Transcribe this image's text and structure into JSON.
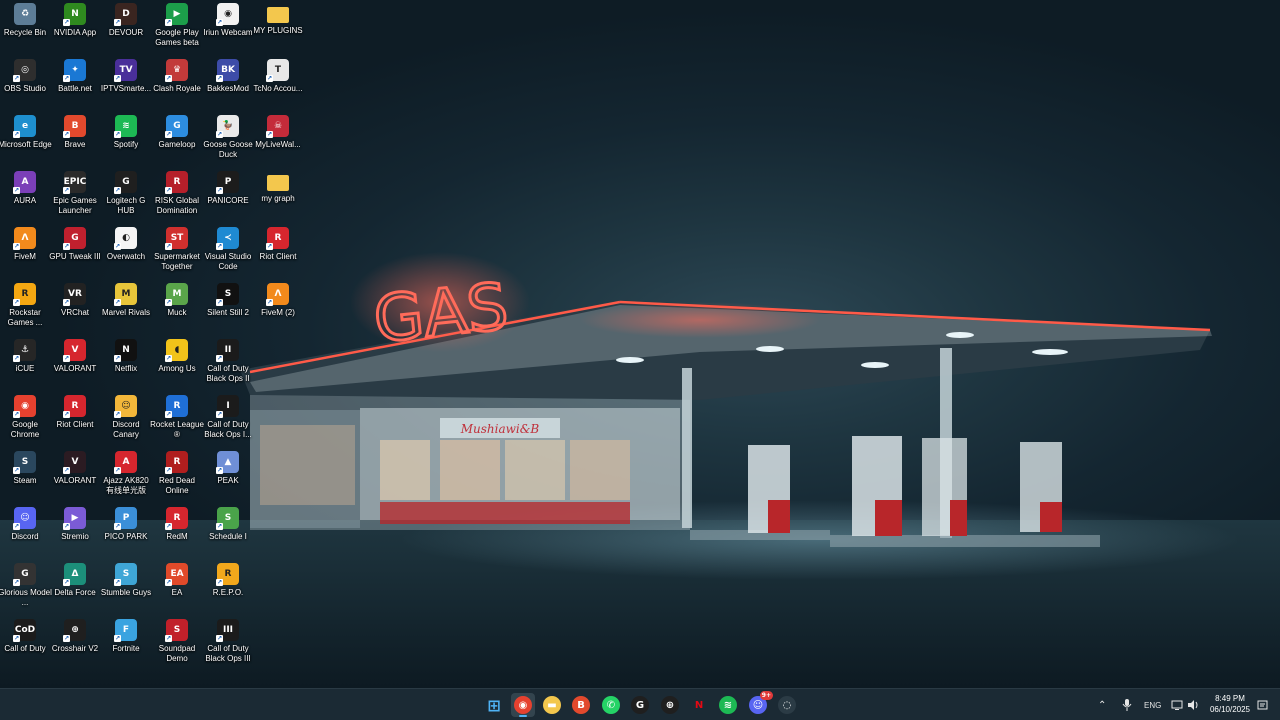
{
  "desktop": {
    "icons": [
      {
        "label": "Recycle Bin",
        "icon": "recycle-bin-icon",
        "color": "#5d7d97",
        "glyph": "♻"
      },
      {
        "label": "NVIDIA App",
        "icon": "nvidia-icon",
        "color": "#2f8a1f",
        "glyph": "N"
      },
      {
        "label": "DEVOUR",
        "icon": "devour-icon",
        "color": "#3a2520",
        "glyph": "D"
      },
      {
        "label": "Google Play Games beta",
        "icon": "google-play-games-icon",
        "color": "#1c9e4a",
        "glyph": "▶"
      },
      {
        "label": "Iriun Webcam",
        "icon": "iriun-webcam-icon",
        "color": "#f2f2f2",
        "glyph": "◉"
      },
      {
        "label": "MY PLUGINS",
        "icon": "folder-icon",
        "color": "#f3c74d",
        "glyph": ""
      },
      {
        "label": "OBS Studio",
        "icon": "obs-studio-icon",
        "color": "#2e2e2e",
        "glyph": "◎"
      },
      {
        "label": "Battle.net",
        "icon": "battlenet-icon",
        "color": "#1a78d4",
        "glyph": "✦"
      },
      {
        "label": "IPTVSmarte...",
        "icon": "iptv-smarters-icon",
        "color": "#4a2f9a",
        "glyph": "TV"
      },
      {
        "label": "Clash Royale",
        "icon": "clash-royale-icon",
        "color": "#c23a3a",
        "glyph": "♛"
      },
      {
        "label": "BakkesMod",
        "icon": "bakkesmod-icon",
        "color": "#3d4ca8",
        "glyph": "BK"
      },
      {
        "label": "TcNo Accou...",
        "icon": "tcno-account-icon",
        "color": "#e8e8e8",
        "glyph": "T"
      },
      {
        "label": "Microsoft Edge",
        "icon": "edge-icon",
        "color": "#1e8fce",
        "glyph": "e"
      },
      {
        "label": "Brave",
        "icon": "brave-icon",
        "color": "#e2492d",
        "glyph": "B"
      },
      {
        "label": "Spotify",
        "icon": "spotify-icon",
        "color": "#1db954",
        "glyph": "≋"
      },
      {
        "label": "Gameloop",
        "icon": "gameloop-icon",
        "color": "#2d8de0",
        "glyph": "G"
      },
      {
        "label": "Goose Goose Duck",
        "icon": "goose-goose-duck-icon",
        "color": "#eaeaea",
        "glyph": "🦆"
      },
      {
        "label": "MyLiveWal...",
        "icon": "mylivewallpaper-icon",
        "color": "#c42b3a",
        "glyph": "☠"
      },
      {
        "label": "AURA",
        "icon": "aura-icon",
        "color": "#7b3fb8",
        "glyph": "A"
      },
      {
        "label": "Epic Games Launcher",
        "icon": "epic-games-icon",
        "color": "#2a2a2a",
        "glyph": "EPIC"
      },
      {
        "label": "Logitech G HUB",
        "icon": "logitech-ghub-icon",
        "color": "#1f1f1f",
        "glyph": "G"
      },
      {
        "label": "RISK Global Domination",
        "icon": "risk-icon",
        "color": "#b51f2a",
        "glyph": "R"
      },
      {
        "label": "PANICORE",
        "icon": "panicore-icon",
        "color": "#1c1c1c",
        "glyph": "P"
      },
      {
        "label": "my graph",
        "icon": "folder-icon",
        "color": "#f3c74d",
        "glyph": ""
      },
      {
        "label": "FiveM",
        "icon": "fivem-icon",
        "color": "#f28a1c",
        "glyph": "Λ"
      },
      {
        "label": "GPU Tweak III",
        "icon": "gpu-tweak-icon",
        "color": "#c0202e",
        "glyph": "G"
      },
      {
        "label": "Overwatch",
        "icon": "overwatch-icon",
        "color": "#f5f5f5",
        "glyph": "◐"
      },
      {
        "label": "Supermarket Together",
        "icon": "supermarket-together-icon",
        "color": "#d0302e",
        "glyph": "ST"
      },
      {
        "label": "Visual Studio Code",
        "icon": "vscode-icon",
        "color": "#1f8ad2",
        "glyph": "≺"
      },
      {
        "label": "Riot Client",
        "icon": "riot-client-icon",
        "color": "#d6262e",
        "glyph": "R"
      },
      {
        "label": "Rockstar Games ...",
        "icon": "rockstar-icon",
        "color": "#f4a712",
        "glyph": "R"
      },
      {
        "label": "VRChat",
        "icon": "vrchat-icon",
        "color": "#222",
        "glyph": "VR"
      },
      {
        "label": "Marvel Rivals",
        "icon": "marvel-rivals-icon",
        "color": "#e7c53a",
        "glyph": "M"
      },
      {
        "label": "Muck",
        "icon": "muck-icon",
        "color": "#5aa54a",
        "glyph": "M"
      },
      {
        "label": "Silent Still 2",
        "icon": "silent-still-icon",
        "color": "#111",
        "glyph": "S"
      },
      {
        "label": "FiveM (2)",
        "icon": "fivem-icon",
        "color": "#f28a1c",
        "glyph": "Λ"
      },
      {
        "label": "iCUE",
        "icon": "icue-icon",
        "color": "#262626",
        "glyph": "⚓"
      },
      {
        "label": "VALORANT",
        "icon": "valorant-icon",
        "color": "#d6262e",
        "glyph": "V"
      },
      {
        "label": "Netflix",
        "icon": "netflix-icon",
        "color": "#111",
        "glyph": "N"
      },
      {
        "label": "Among Us",
        "icon": "among-us-icon",
        "color": "#f2c31a",
        "glyph": "◖"
      },
      {
        "label": "Call of Duty Black Ops II",
        "icon": "cod-bo2-icon",
        "color": "#1b1b1b",
        "glyph": "II"
      },
      null,
      {
        "label": "Google Chrome",
        "icon": "chrome-icon",
        "color": "#e6412f",
        "glyph": "◉"
      },
      {
        "label": "Riot Client",
        "icon": "riot-client-icon",
        "color": "#d6262e",
        "glyph": "R"
      },
      {
        "label": "Discord Canary",
        "icon": "discord-canary-icon",
        "color": "#f3b73a",
        "glyph": "☺"
      },
      {
        "label": "Rocket League ®",
        "icon": "rocket-league-icon",
        "color": "#1f6fd6",
        "glyph": "R"
      },
      {
        "label": "Call of Duty Black Ops I...",
        "icon": "cod-bo-icon",
        "color": "#1b1b1b",
        "glyph": "I"
      },
      null,
      {
        "label": "Steam",
        "icon": "steam-icon",
        "color": "#2a475e",
        "glyph": "S"
      },
      {
        "label": "VALORANT",
        "icon": "valorant-icon",
        "color": "#2b1b22",
        "glyph": "V"
      },
      {
        "label": "Ajazz AK820 有线单光版",
        "icon": "ajazz-icon",
        "color": "#d6262e",
        "glyph": "A"
      },
      {
        "label": "Red Dead Online",
        "icon": "red-dead-online-icon",
        "color": "#b01e1e",
        "glyph": "R"
      },
      {
        "label": "PEAK",
        "icon": "peak-icon",
        "color": "#6f8fd6",
        "glyph": "▲"
      },
      null,
      {
        "label": "Discord",
        "icon": "discord-icon",
        "color": "#5865f2",
        "glyph": "☺"
      },
      {
        "label": "Stremio",
        "icon": "stremio-icon",
        "color": "#7b5bd6",
        "glyph": "▶"
      },
      {
        "label": "PICO PARK",
        "icon": "pico-park-icon",
        "color": "#3b8fd8",
        "glyph": "P"
      },
      {
        "label": "RedM",
        "icon": "redm-icon",
        "color": "#d6262e",
        "glyph": "R"
      },
      {
        "label": "Schedule I",
        "icon": "schedule-i-icon",
        "color": "#4aa34a",
        "glyph": "S"
      },
      null,
      {
        "label": "Glorious Model ...",
        "icon": "glorious-icon",
        "color": "#333",
        "glyph": "G"
      },
      {
        "label": "Delta Force",
        "icon": "delta-force-icon",
        "color": "#1c8f7a",
        "glyph": "Δ"
      },
      {
        "label": "Stumble Guys",
        "icon": "stumble-guys-icon",
        "color": "#3fa6d6",
        "glyph": "S"
      },
      {
        "label": "EA",
        "icon": "ea-icon",
        "color": "#e04a2a",
        "glyph": "EA"
      },
      {
        "label": "R.E.P.O.",
        "icon": "repo-icon",
        "color": "#f2a81c",
        "glyph": "R"
      },
      null,
      {
        "label": "Call of Duty",
        "icon": "call-of-duty-icon",
        "color": "#1b1b1b",
        "glyph": "CoD"
      },
      {
        "label": "Crosshair V2",
        "icon": "crosshair-v2-icon",
        "color": "#1f1f1f",
        "glyph": "⊕"
      },
      {
        "label": "Fortnite",
        "icon": "fortnite-icon",
        "color": "#3aa3e0",
        "glyph": "F"
      },
      {
        "label": "Soundpad Demo",
        "icon": "soundpad-icon",
        "color": "#c1202a",
        "glyph": "S"
      },
      {
        "label": "Call of Duty Black Ops III",
        "icon": "cod-bo3-icon",
        "color": "#1b1b1b",
        "glyph": "III"
      }
    ]
  },
  "wallpaper": {
    "sign_text": "GAS",
    "store_sign": "Mushiawi&B"
  },
  "taskbar": {
    "apps": [
      {
        "name": "start-button",
        "glyph": "⊞",
        "color": "#4fb3f5"
      },
      {
        "name": "taskbar-chrome",
        "glyph": "◉",
        "color": "#e6412f",
        "active": true
      },
      {
        "name": "taskbar-file-explorer",
        "glyph": "▬",
        "color": "#f3c74d"
      },
      {
        "name": "taskbar-brave",
        "glyph": "B",
        "color": "#e2492d"
      },
      {
        "name": "taskbar-whatsapp",
        "glyph": "✆",
        "color": "#25d366"
      },
      {
        "name": "taskbar-logitech-ghub",
        "glyph": "G",
        "color": "#1f1f1f"
      },
      {
        "name": "taskbar-crosshair",
        "glyph": "⊕",
        "color": "#1f1f1f"
      },
      {
        "name": "taskbar-netflix",
        "glyph": "N",
        "color": "#1b2a34"
      },
      {
        "name": "taskbar-spotify",
        "glyph": "≋",
        "color": "#1db954"
      },
      {
        "name": "taskbar-discord",
        "glyph": "☺",
        "color": "#5865f2",
        "badge": "9+"
      },
      {
        "name": "taskbar-steam-like",
        "glyph": "◌",
        "color": "#2b3b45"
      }
    ],
    "tray": {
      "language": "ENG",
      "time": "8:49 PM",
      "date": "06/10/2025"
    }
  }
}
